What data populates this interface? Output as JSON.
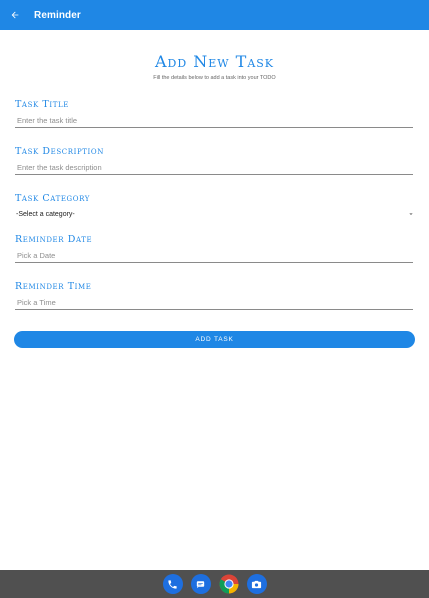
{
  "appbar": {
    "title": "Reminder",
    "color": "#1f87e5",
    "back_icon": "arrow-back-icon"
  },
  "form": {
    "heading": "Add New Task",
    "subheading": "Fill the details below to add a task into your TODO",
    "task_title": {
      "label": "Task Title",
      "placeholder": "Enter the task title"
    },
    "task_description": {
      "label": "Task Description",
      "placeholder": "Enter the task description"
    },
    "task_category": {
      "label": "Task Category",
      "selected": "-Select a category-",
      "icon": "arrow-drop-down-icon"
    },
    "reminder_date": {
      "label": "Reminder Date",
      "placeholder": "Pick a Date"
    },
    "reminder_time": {
      "label": "Reminder Time",
      "placeholder": "Pick a Time"
    },
    "submit_label": "Add Task"
  },
  "dock": {
    "icons": [
      "phone-icon",
      "messages-icon",
      "chrome-icon",
      "camera-icon"
    ]
  }
}
